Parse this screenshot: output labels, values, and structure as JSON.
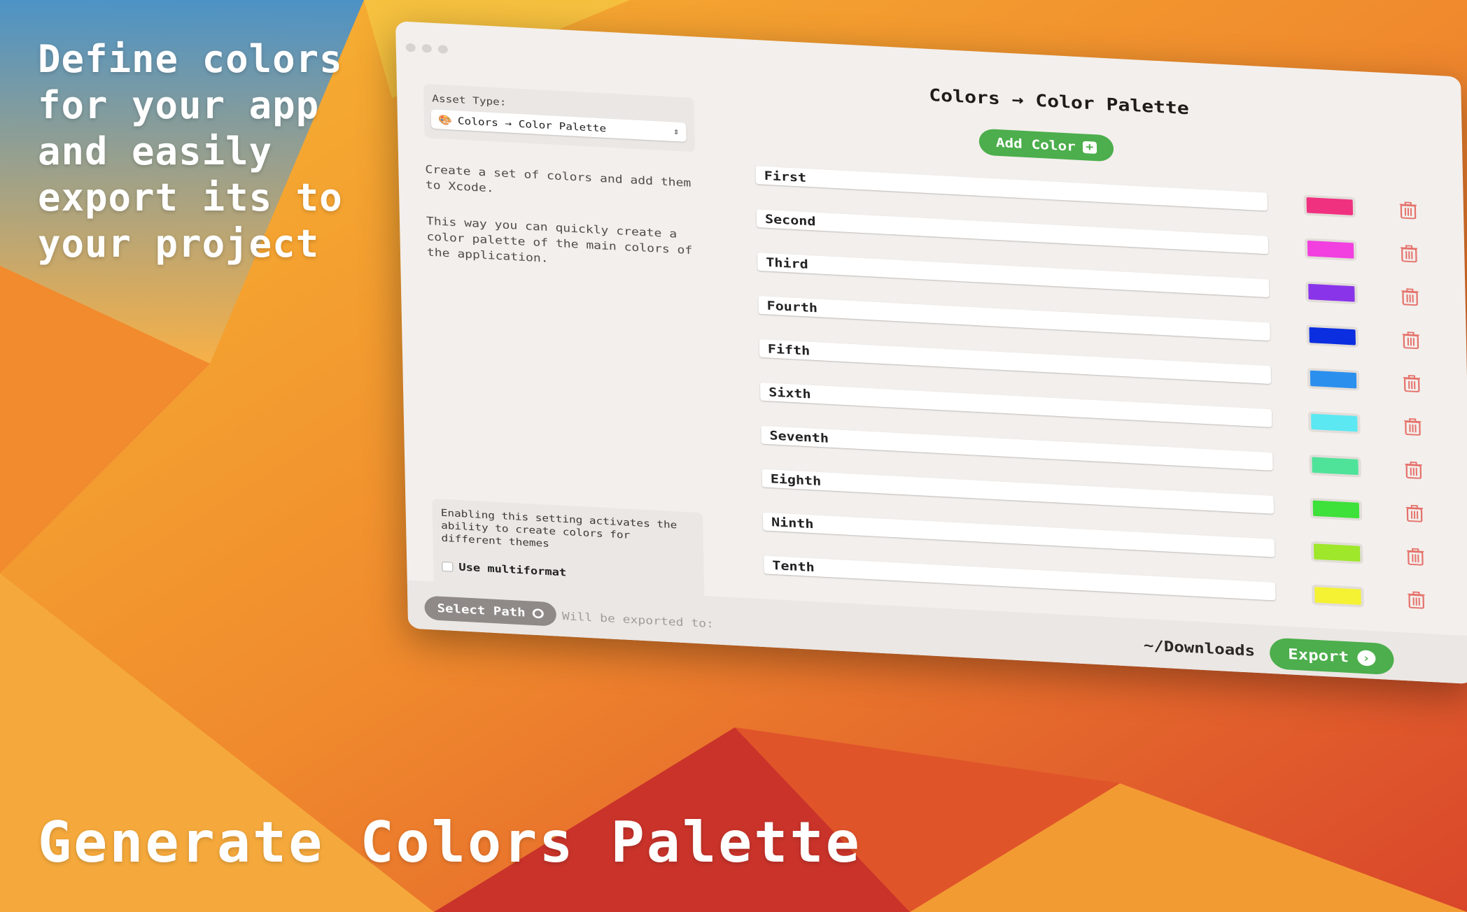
{
  "promo": {
    "headline": "Define colors for your app and easily export its to your project",
    "footer_title": "Generate Colors Palette"
  },
  "window": {
    "title": "Colors → Color Palette",
    "asset_type_label": "Asset Type:",
    "asset_type_value": "Colors → Color Palette",
    "description_1": "Create a set of colors and add them to Xcode.",
    "description_2": "This way you can quickly create a color palette of the main colors of the application.",
    "multiformat_help": "Enabling this setting activates the ability to create colors for different themes",
    "multiformat_label": "Use multiformat",
    "add_color_label": "Add Color",
    "select_path_label": "Select Path",
    "export_placeholder": "Will be exported to:",
    "export_path": "~/Downloads",
    "export_label": "Export"
  },
  "colors": [
    {
      "name": "First",
      "hex": "#f0317f"
    },
    {
      "name": "Second",
      "hex": "#f23fe0"
    },
    {
      "name": "Third",
      "hex": "#8a34ea"
    },
    {
      "name": "Fourth",
      "hex": "#0a2ee0"
    },
    {
      "name": "Fifth",
      "hex": "#2b8fee"
    },
    {
      "name": "Sixth",
      "hex": "#5be8f2"
    },
    {
      "name": "Seventh",
      "hex": "#4fe39a"
    },
    {
      "name": "Eighth",
      "hex": "#3ee03a"
    },
    {
      "name": "Ninth",
      "hex": "#9ee72b"
    },
    {
      "name": "Tenth",
      "hex": "#f4f232"
    }
  ],
  "theme": {
    "accent_green": "#4cae4c",
    "delete_red": "#e5716b"
  }
}
